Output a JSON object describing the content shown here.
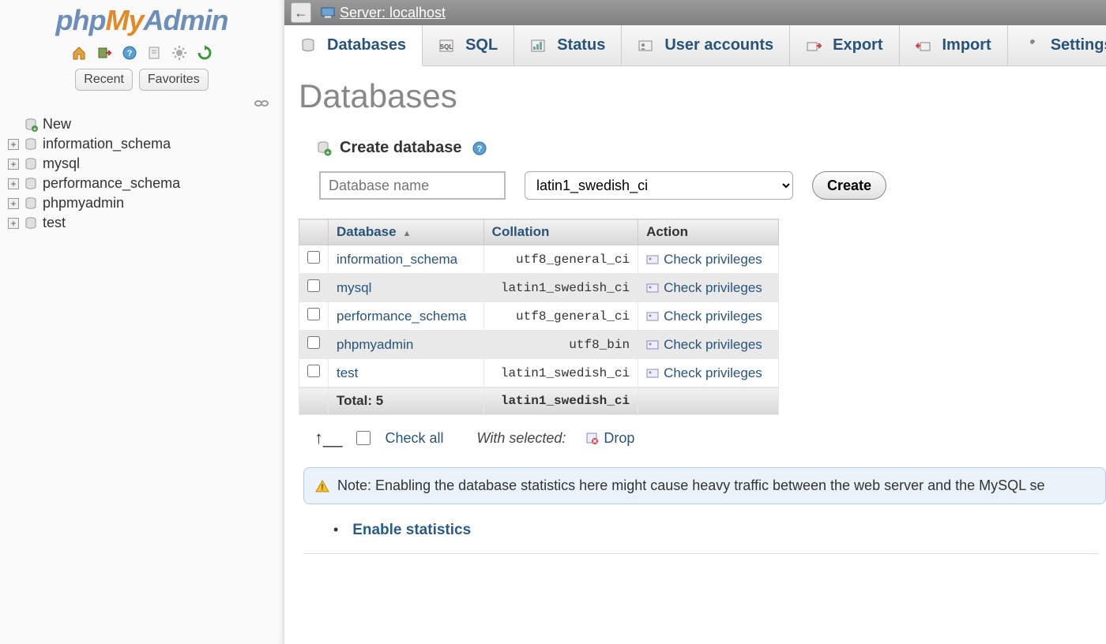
{
  "logo": {
    "php": "php",
    "my": "My",
    "admin": "Admin"
  },
  "sidebar": {
    "tabs": {
      "recent": "Recent",
      "favorites": "Favorites"
    },
    "new_label": "New",
    "items": [
      {
        "name": "information_schema"
      },
      {
        "name": "mysql"
      },
      {
        "name": "performance_schema"
      },
      {
        "name": "phpmyadmin"
      },
      {
        "name": "test"
      }
    ]
  },
  "server": {
    "label": "Server: localhost"
  },
  "tabs": [
    {
      "key": "databases",
      "label": "Databases",
      "active": true
    },
    {
      "key": "sql",
      "label": "SQL"
    },
    {
      "key": "status",
      "label": "Status"
    },
    {
      "key": "users",
      "label": "User accounts"
    },
    {
      "key": "export",
      "label": "Export"
    },
    {
      "key": "import",
      "label": "Import"
    },
    {
      "key": "settings",
      "label": "Settings"
    }
  ],
  "page": {
    "title": "Databases"
  },
  "create": {
    "heading": "Create database",
    "name_placeholder": "Database name",
    "collation_selected": "latin1_swedish_ci",
    "button": "Create"
  },
  "table": {
    "headers": {
      "database": "Database",
      "collation": "Collation",
      "action": "Action"
    },
    "action_label": "Check privileges",
    "rows": [
      {
        "db": "information_schema",
        "collation": "utf8_general_ci"
      },
      {
        "db": "mysql",
        "collation": "latin1_swedish_ci"
      },
      {
        "db": "performance_schema",
        "collation": "utf8_general_ci"
      },
      {
        "db": "phpmyadmin",
        "collation": "utf8_bin"
      },
      {
        "db": "test",
        "collation": "latin1_swedish_ci"
      }
    ],
    "total": {
      "label": "Total: 5",
      "collation": "latin1_swedish_ci"
    }
  },
  "bulk": {
    "check_all": "Check all",
    "with_selected": "With selected:",
    "drop": "Drop"
  },
  "note": "Note: Enabling the database statistics here might cause heavy traffic between the web server and the MySQL se",
  "stats_link": "Enable statistics"
}
